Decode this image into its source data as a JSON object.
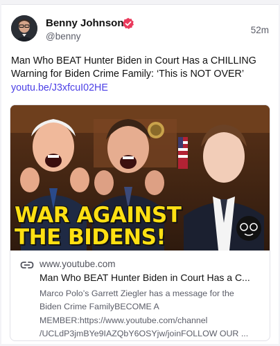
{
  "post": {
    "author": {
      "display_name": "Benny Johnson",
      "handle": "@benny",
      "verified_badge": "verified-check-icon"
    },
    "timestamp": "52m",
    "text": "Man Who BEAT Hunter Biden in Court Has a CHILLING Warning for Biden Crime Family: ‘This is NOT OVER’",
    "link_text": "youtu.be/J3xfcuI02HE"
  },
  "embed": {
    "thumbnail_caption": {
      "line1": "WAR AGAINST",
      "line2": "THE BIDENS!"
    },
    "domain": "www.youtube.com",
    "title": "Man Who BEAT Hunter Biden in Court Has a C...",
    "description_lines": [
      "Marco Polo’s Garrett Ziegler has a message for the",
      "Biden Crime FamilyBECOME A",
      "MEMBER:https://www.youtube.com/channel",
      "/UCLdP3jmBYe9IAZQbY6OSYjw/joinFOLLOW OUR ..."
    ]
  },
  "colors": {
    "link": "#4b3fe6",
    "verified": "#ea3a5c",
    "banner_text": "#ffe013"
  }
}
